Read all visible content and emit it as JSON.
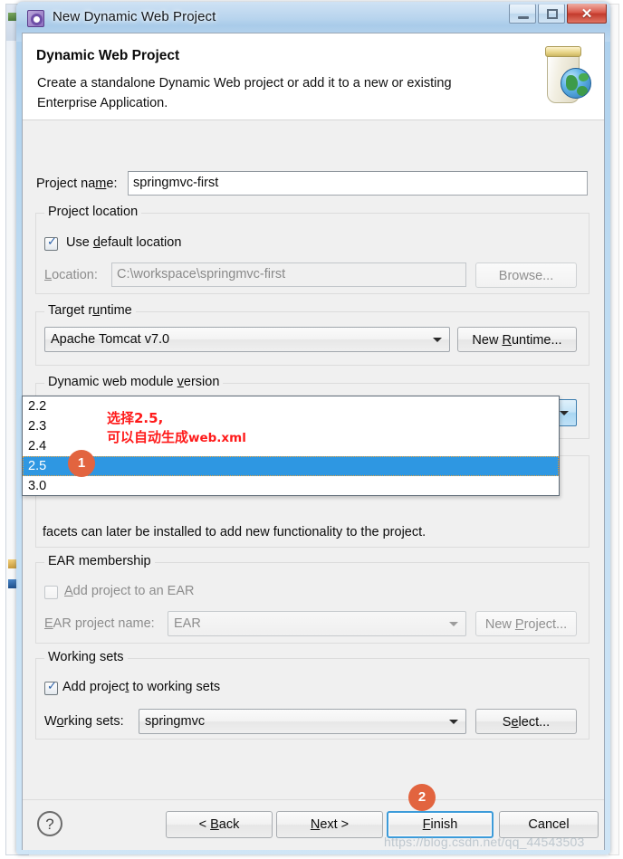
{
  "window": {
    "title": "New Dynamic Web Project",
    "icon": "eclipse-gear-icon",
    "minimize_label": "–",
    "maximize_label": "□",
    "close_label": "✕"
  },
  "header": {
    "title": "Dynamic Web Project",
    "description": "Create a standalone Dynamic Web project or add it to a new or existing Enterprise Application.",
    "icon": "web-project-jar-globe-icon"
  },
  "form": {
    "project_name": {
      "label": "Project na̱me:",
      "label_plain": "Project name:",
      "value": "springmvc-first"
    },
    "project_location": {
      "group_title": "Project location",
      "use_default_label": "Use default location",
      "use_default_checked": true,
      "location_label": "Location:",
      "location_value": "C:\\workspace\\springmvc-first",
      "browse_label": "Browse...",
      "browse_disabled": true
    },
    "target_runtime": {
      "group_title": "Target runtime",
      "value": "Apache Tomcat v7.0",
      "new_runtime_label": "New Runtime..."
    },
    "module_version": {
      "group_title": "Dynamic web module version",
      "value": "3.0",
      "options": [
        "2.2",
        "2.3",
        "2.4",
        "2.5",
        "3.0"
      ],
      "highlighted_option": "2.5",
      "dropdown_open": true
    },
    "configuration": {
      "description_tail": "facets can later be installed to add new functionality to the project."
    },
    "ear_membership": {
      "group_title": "EAR membership",
      "add_to_ear_label": "Add project to an EAR",
      "add_to_ear_checked": false,
      "add_to_ear_disabled": true,
      "ear_project_label": "EAR project name:",
      "ear_project_value": "EAR",
      "new_project_label": "New Project...",
      "new_project_disabled": true
    },
    "working_sets": {
      "group_title": "Working sets",
      "add_to_working_sets_label": "Add project to working sets",
      "add_to_working_sets_checked": true,
      "working_sets_label": "Wo̱rking sets:",
      "working_sets_label_plain": "Working sets:",
      "working_sets_value": "springmvc",
      "select_label": "Select..."
    }
  },
  "footer": {
    "help_label": "?",
    "back_label": "< Back",
    "next_label": "Next >",
    "finish_label": "Finish",
    "cancel_label": "Cancel",
    "focused_button": "Finish"
  },
  "annotations": {
    "note_line1": "选择2.5,",
    "note_line2_cn": "可以自动生成",
    "note_line2_en": "web.xml",
    "badge_1": "1",
    "badge_2": "2",
    "color": "#ff1a1a",
    "badge_color": "#e2643f"
  },
  "watermark": {
    "text": "https://blog.csdn.net/qq_44543503"
  }
}
